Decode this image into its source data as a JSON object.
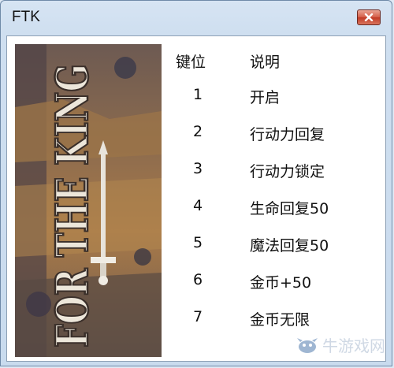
{
  "window": {
    "title": "FTK",
    "close_icon": "close-icon"
  },
  "banner": {
    "logo_text": "FOR THE KING",
    "icon": "sword-icon"
  },
  "table": {
    "headers": {
      "key": "键位",
      "desc": "说明"
    },
    "rows": [
      {
        "key": "1",
        "desc": "开启"
      },
      {
        "key": "2",
        "desc": "行动力回复"
      },
      {
        "key": "3",
        "desc": "行动力锁定"
      },
      {
        "key": "4",
        "desc": "生命回复50"
      },
      {
        "key": "5",
        "desc": "魔法回复50"
      },
      {
        "key": "6",
        "desc": "金币+50"
      },
      {
        "key": "7",
        "desc": "金币无限"
      }
    ]
  },
  "watermark": {
    "text": "牛游戏网",
    "icon": "bird-logo-icon"
  },
  "colors": {
    "titlebar": "#d6e4f3",
    "close_button": "#c13a24",
    "client_bg": "#ffffff"
  }
}
